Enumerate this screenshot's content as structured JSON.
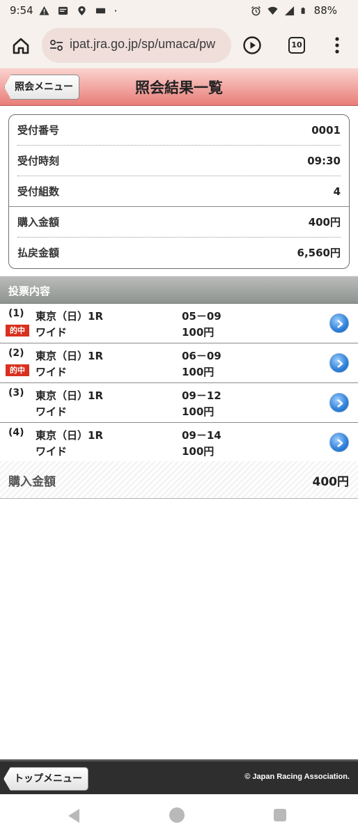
{
  "status_bar": {
    "time": "9:54",
    "battery": "88%",
    "icons": [
      "warning-icon",
      "news-icon",
      "location-icon",
      "cast-icon",
      "alarm-icon",
      "wifi-icon",
      "signal-icon",
      "battery-icon"
    ]
  },
  "browser": {
    "url": "ipat.jra.go.jp/sp/umaca/pw",
    "tab_count": "10"
  },
  "header": {
    "back_label": "照会メニュー",
    "title": "照会結果一覧",
    "gradient_top": "#fbd3cf",
    "gradient_bottom": "#e87d78"
  },
  "summary": {
    "rows": [
      {
        "label": "受付番号",
        "value": "0001"
      },
      {
        "label": "受付時刻",
        "value": "09:30"
      },
      {
        "label": "受付組数",
        "value": "4"
      },
      {
        "label": "購入金額",
        "value": "400円"
      },
      {
        "label": "払戻金額",
        "value": "6,560円"
      }
    ]
  },
  "section": {
    "title": "投票内容"
  },
  "bets": [
    {
      "no": "(1)",
      "badge": "的中",
      "race": "東京（日）1R",
      "type": "ワイド",
      "combo": "05－09",
      "amount": "100円"
    },
    {
      "no": "(2)",
      "badge": "的中",
      "race": "東京（日）1R",
      "type": "ワイド",
      "combo": "06－09",
      "amount": "100円"
    },
    {
      "no": "(3)",
      "badge": "",
      "race": "東京（日）1R",
      "type": "ワイド",
      "combo": "09－12",
      "amount": "100円"
    },
    {
      "no": "(4)",
      "badge": "",
      "race": "東京（日）1R",
      "type": "ワイド",
      "combo": "09－14",
      "amount": "100円"
    }
  ],
  "total": {
    "label": "購入金額",
    "value": "400円"
  },
  "footer": {
    "top_menu_label": "トップメニュー",
    "copyright": "© Japan Racing Association."
  },
  "colors": {
    "hit_badge": "#d9301f",
    "arrow_button": "#2f7fd8"
  }
}
